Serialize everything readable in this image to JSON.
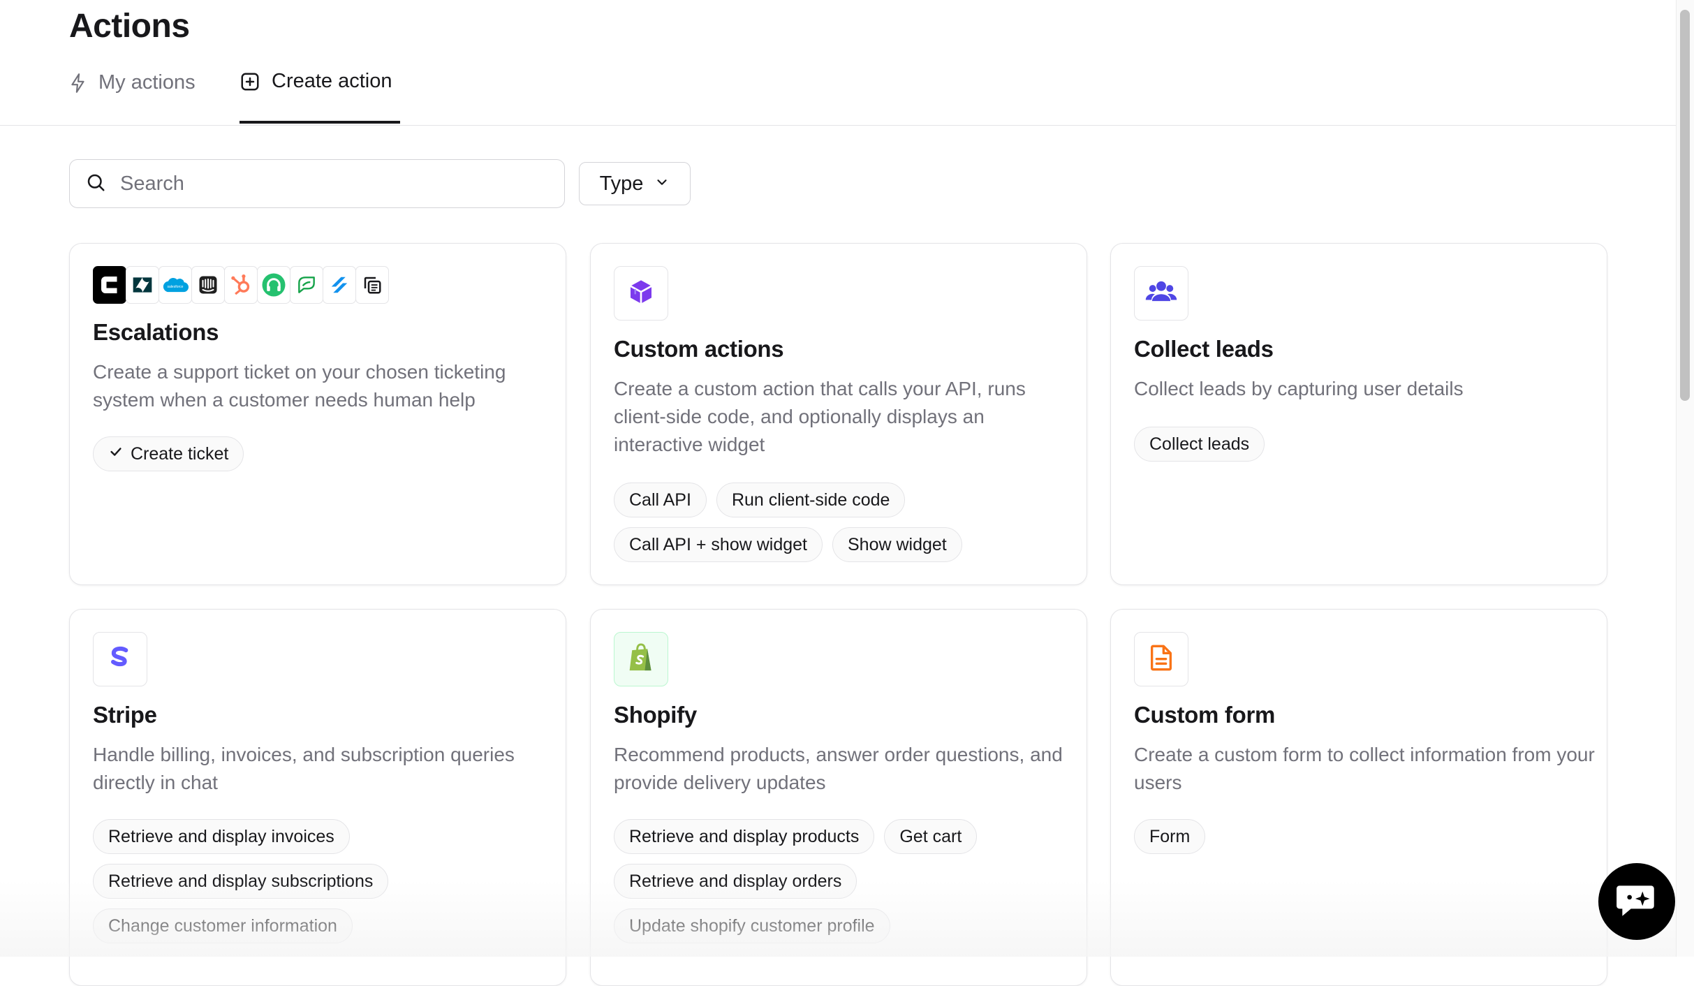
{
  "header": {
    "title": "Actions",
    "tabs": [
      {
        "label": "My actions",
        "icon": "lightning-icon",
        "active": false
      },
      {
        "label": "Create action",
        "icon": "plus-square-icon",
        "active": true
      }
    ]
  },
  "filters": {
    "search_placeholder": "Search",
    "type_label": "Type"
  },
  "cards": [
    {
      "title": "Escalations",
      "description": "Create a support ticket on your chosen ticketing system when a customer needs human help",
      "icons": [
        "chatbase-logo",
        "zendesk-logo",
        "salesforce-logo",
        "intercom-logo",
        "hubspot-logo",
        "freshdesk-logo",
        "zoho-desk-logo",
        "helpscout-logo",
        "copy-icon"
      ],
      "chips": [
        "Create ticket"
      ]
    },
    {
      "title": "Custom actions",
      "description": "Create a custom action that calls your API, runs client-side code, and optionally displays an interactive widget",
      "icon": "cube-icon",
      "chips": [
        "Call API",
        "Run client-side code",
        "Call API + show widget",
        "Show widget"
      ]
    },
    {
      "title": "Collect leads",
      "description": "Collect leads by capturing user details",
      "icon": "users-icon",
      "chips": [
        "Collect leads"
      ]
    },
    {
      "title": "Stripe",
      "description": "Handle billing, invoices, and subscription queries directly in chat",
      "icon": "stripe-icon",
      "chips": [
        "Retrieve and display invoices",
        "Retrieve and display subscriptions",
        "Change customer information"
      ]
    },
    {
      "title": "Shopify",
      "description": "Recommend products, answer order questions, and provide delivery updates",
      "icon": "shopify-icon",
      "chips": [
        "Retrieve and display products",
        "Get cart",
        "Retrieve and display orders",
        "Update shopify customer profile"
      ]
    },
    {
      "title": "Custom form",
      "description": "Create a custom form to collect information from your users",
      "icon": "document-icon",
      "chips": [
        "Form"
      ]
    }
  ],
  "colors": {
    "custom_action_purple": "#7c3aed",
    "leads_indigo": "#4f46e5",
    "stripe_purple": "#635bff",
    "shopify_green": "#95bf47",
    "form_orange": "#f97316"
  }
}
